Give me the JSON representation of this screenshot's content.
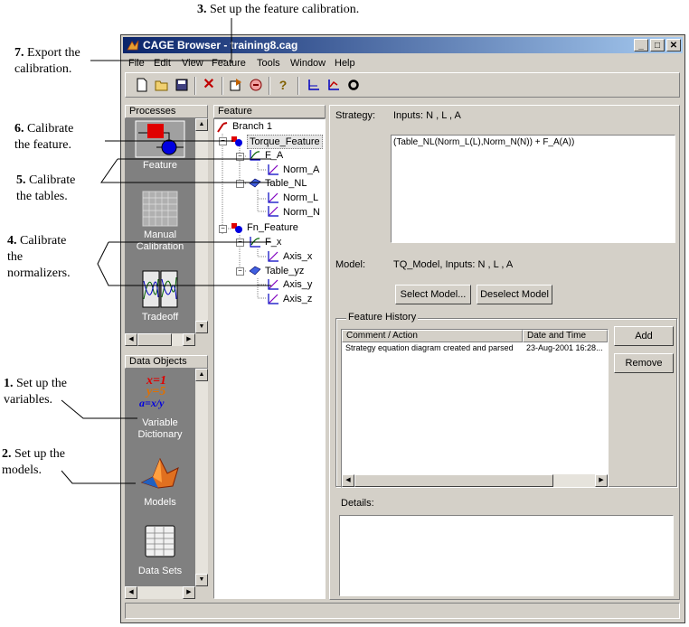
{
  "annotations": {
    "a3": {
      "num": "3.",
      "text": "Set up the feature calibration."
    },
    "a7": {
      "num": "7.",
      "line1": "Export the",
      "line2": "calibration."
    },
    "a6": {
      "num": "6.",
      "line1": "Calibrate",
      "line2": "the feature."
    },
    "a5": {
      "num": "5.",
      "line1": "Calibrate",
      "line2": "the tables."
    },
    "a4": {
      "num": "4.",
      "line1": "Calibrate",
      "line2": "the",
      "line3": "normalizers."
    },
    "a1": {
      "num": "1.",
      "line1": "Set up the",
      "line2": "variables."
    },
    "a2": {
      "num": "2.",
      "line1": "Set up the",
      "line2": "models."
    }
  },
  "window": {
    "title": "CAGE Browser - training8.cag"
  },
  "menu": [
    "File",
    "Edit",
    "View",
    "Feature",
    "Tools",
    "Window",
    "Help"
  ],
  "processes": {
    "header": "Processes",
    "items": [
      {
        "label": "Feature"
      },
      {
        "label1": "Manual",
        "label2": "Calibration"
      },
      {
        "label": "Tradeoff"
      }
    ]
  },
  "data_objects": {
    "header": "Data Objects",
    "items": [
      {
        "label1": "Variable",
        "label2": "Dictionary"
      },
      {
        "label": "Models"
      },
      {
        "label": "Data Sets"
      }
    ],
    "var_icon_lines": [
      "x=1",
      "y=5",
      "a=x/y"
    ]
  },
  "tree": {
    "header": "Feature",
    "nodes": [
      "Branch 1",
      "Torque_Feature",
      "F_A",
      "Norm_A",
      "Table_NL",
      "Norm_L",
      "Norm_N",
      "Fn_Feature",
      "F_x",
      "Axis_x",
      "Table_yz",
      "Axis_y",
      "Axis_z"
    ]
  },
  "detail": {
    "strategy_label": "Strategy:",
    "strategy_inputs": "Inputs: N , L , A",
    "equation": "(Table_NL(Norm_L(L),Norm_N(N)) + F_A(A))",
    "model_label": "Model:",
    "model_value": "TQ_Model,   Inputs: N , L , A",
    "select_model": "Select Model...",
    "deselect_model": "Deselect Model",
    "history_title": "Feature History",
    "col_comment": "Comment / Action",
    "col_date": "Date and Time",
    "history_rows": [
      {
        "comment": "Strategy equation diagram created and parsed",
        "date": "23-Aug-2001 16:28..."
      }
    ],
    "add": "Add",
    "remove": "Remove",
    "details_label": "Details:"
  }
}
